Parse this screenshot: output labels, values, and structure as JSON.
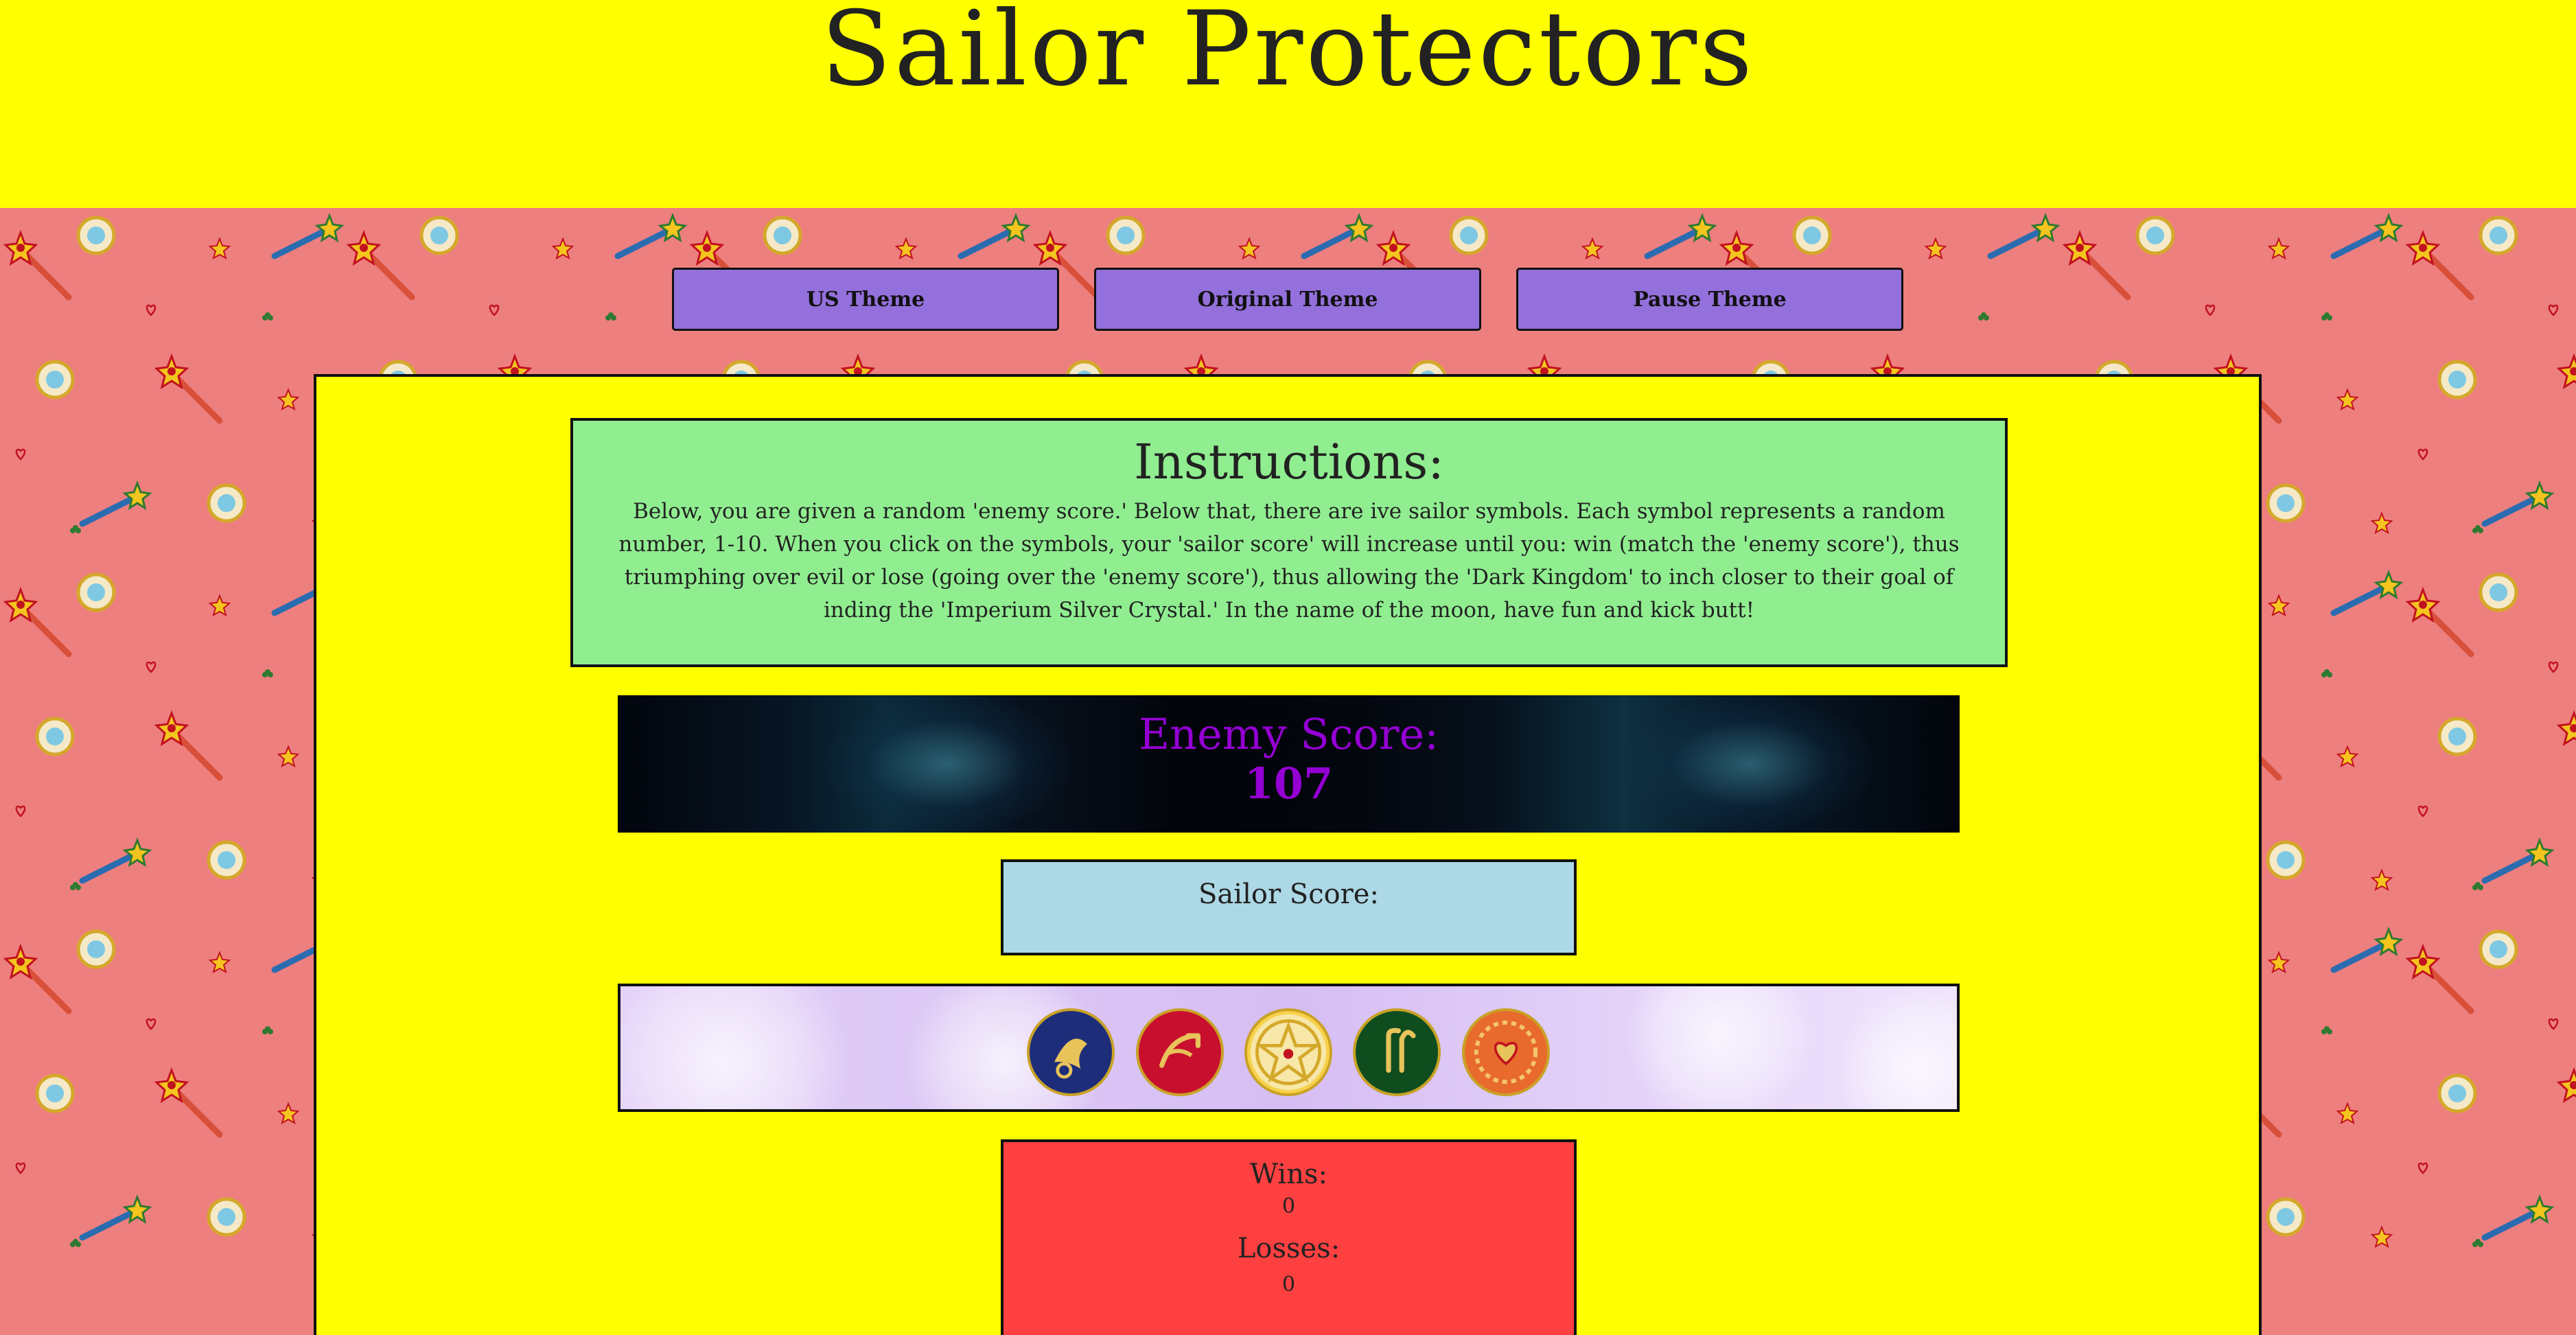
{
  "header": {
    "title": "Sailor Protectors"
  },
  "theme_buttons": [
    {
      "label": "US Theme"
    },
    {
      "label": "Original Theme"
    },
    {
      "label": "Pause Theme"
    }
  ],
  "instructions": {
    "heading": "Instructions:",
    "body": "Below, you are given a random 'enemy score.' Below that, there are ive sailor symbols. Each symbol represents a random number, 1-10. When you click on the symbols, your 'sailor score' will increase until you: win (match the 'enemy score'), thus triumphing over evil or lose (going over the 'enemy score'), thus allowing the 'Dark Kingdom' to inch closer to their goal of inding the 'Imperium Silver Crystal.' In the name of the moon, have fun and kick butt!"
  },
  "enemy": {
    "label": "Enemy Score:",
    "value": "107"
  },
  "sailor": {
    "label": "Sailor Score:"
  },
  "symbols": [
    {
      "name": "mercury-symbol-icon",
      "color": "#1e2d7a"
    },
    {
      "name": "mars-symbol-icon",
      "color": "#c8102e"
    },
    {
      "name": "moon-star-symbol-icon",
      "color": "#f7d14a"
    },
    {
      "name": "jupiter-symbol-icon",
      "color": "#0f4d1f"
    },
    {
      "name": "venus-symbol-icon",
      "color": "#e86a2c"
    }
  ],
  "scoreboard": {
    "wins_label": "Wins:",
    "wins_value": "0",
    "losses_label": "Losses:",
    "losses_value": "0"
  },
  "colors": {
    "header_bg": "#ffff00",
    "page_bg": "#ee7f7f",
    "button_bg": "#9370db",
    "instructions_bg": "#90ee90",
    "enemy_text": "#9400d3",
    "sailor_bg": "#add8e6",
    "scoreboard_bg": "#ff4040"
  }
}
